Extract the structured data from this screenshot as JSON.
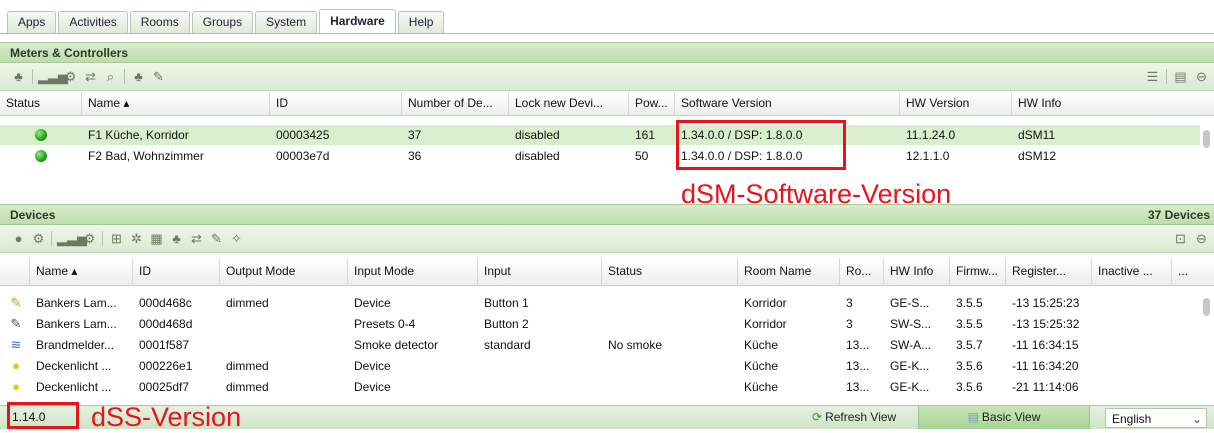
{
  "tabs": [
    "Apps",
    "Activities",
    "Rooms",
    "Groups",
    "System",
    "Hardware",
    "Help"
  ],
  "active_tab": "Hardware",
  "meters": {
    "title": "Meters & Controllers",
    "columns": [
      "Status",
      "Name ▴",
      "ID",
      "Number of De...",
      "Lock new Devi...",
      "Pow...",
      "Software Version",
      "HW Version",
      "HW Info"
    ],
    "rows": [
      {
        "name": "F1 Küche, Korridor",
        "id": "00003425",
        "devices": "37",
        "lock": "disabled",
        "power": "161",
        "software": "1.34.0.0 / DSP: 1.8.0.0",
        "hw_version": "11.1.24.0",
        "hw_info": "dSM11"
      },
      {
        "name": "F2 Bad, Wohnzimmer",
        "id": "00003e7d",
        "devices": "36",
        "lock": "disabled",
        "power": "50",
        "software": "1.34.0.0 / DSP: 1.8.0.0",
        "hw_version": "12.1.1.0",
        "hw_info": "dSM12"
      }
    ]
  },
  "devices": {
    "title": "Devices",
    "count": "37 Devices",
    "columns": [
      "Name ▴",
      "ID",
      "Output Mode",
      "Input Mode",
      "Input",
      "Status",
      "Room Name",
      "Ro...",
      "HW Info",
      "Firmw...",
      "Register...",
      "Inactive ...",
      "..."
    ],
    "rows": [
      {
        "icon": "pencil-lamp-icon",
        "glyph": "✎",
        "name": "Bankers Lam...",
        "id": "000d468c",
        "output": "dimmed",
        "input_mode": "Device",
        "input": "Button 1",
        "status": "",
        "room": "Korridor",
        "ro": "3",
        "hw": "GE-S...",
        "fw": "3.5.5",
        "reg": "-13 15:25:23"
      },
      {
        "icon": "pencil-lamp-icon",
        "glyph": "✎",
        "name": "Bankers Lam...",
        "id": "000d468d",
        "output": "",
        "input_mode": "Presets 0-4",
        "input": "Button 2",
        "status": "",
        "room": "Korridor",
        "ro": "3",
        "hw": "SW-S...",
        "fw": "3.5.5",
        "reg": "-13 15:25:32"
      },
      {
        "icon": "smoke-detector-icon",
        "glyph": "≋",
        "name": "Brandmelder...",
        "id": "0001f587",
        "output": "",
        "input_mode": "Smoke detector",
        "input": "standard",
        "status": "No smoke",
        "room": "Küche",
        "ro": "13...",
        "hw": "SW-A...",
        "fw": "3.5.7",
        "reg": "-11 16:34:15"
      },
      {
        "icon": "light-icon",
        "glyph": "●",
        "name": "Deckenlicht ...",
        "id": "000226e1",
        "output": "dimmed",
        "input_mode": "Device",
        "input": "",
        "status": "",
        "room": "Küche",
        "ro": "13...",
        "hw": "GE-K...",
        "fw": "3.5.6",
        "reg": "-11 16:34:20"
      },
      {
        "icon": "light-icon",
        "glyph": "●",
        "name": "Deckenlicht ...",
        "id": "00025df7",
        "output": "dimmed",
        "input_mode": "Device",
        "input": "",
        "status": "",
        "room": "Küche",
        "ro": "13...",
        "hw": "GE-K...",
        "fw": "3.5.6",
        "reg": "-21 11:14:06"
      }
    ]
  },
  "status_bar": {
    "version": "1.14.0",
    "refresh_label": "Refresh View",
    "basic_view_label": "Basic View",
    "language": "English"
  },
  "annotations": {
    "software_label": "dSM-Software-Version",
    "dss_label": "dSS-Version"
  },
  "colors": {
    "annotation": "#e8141c",
    "panel_header": "#c8e4b9",
    "selected_row": "#d9eecd"
  }
}
